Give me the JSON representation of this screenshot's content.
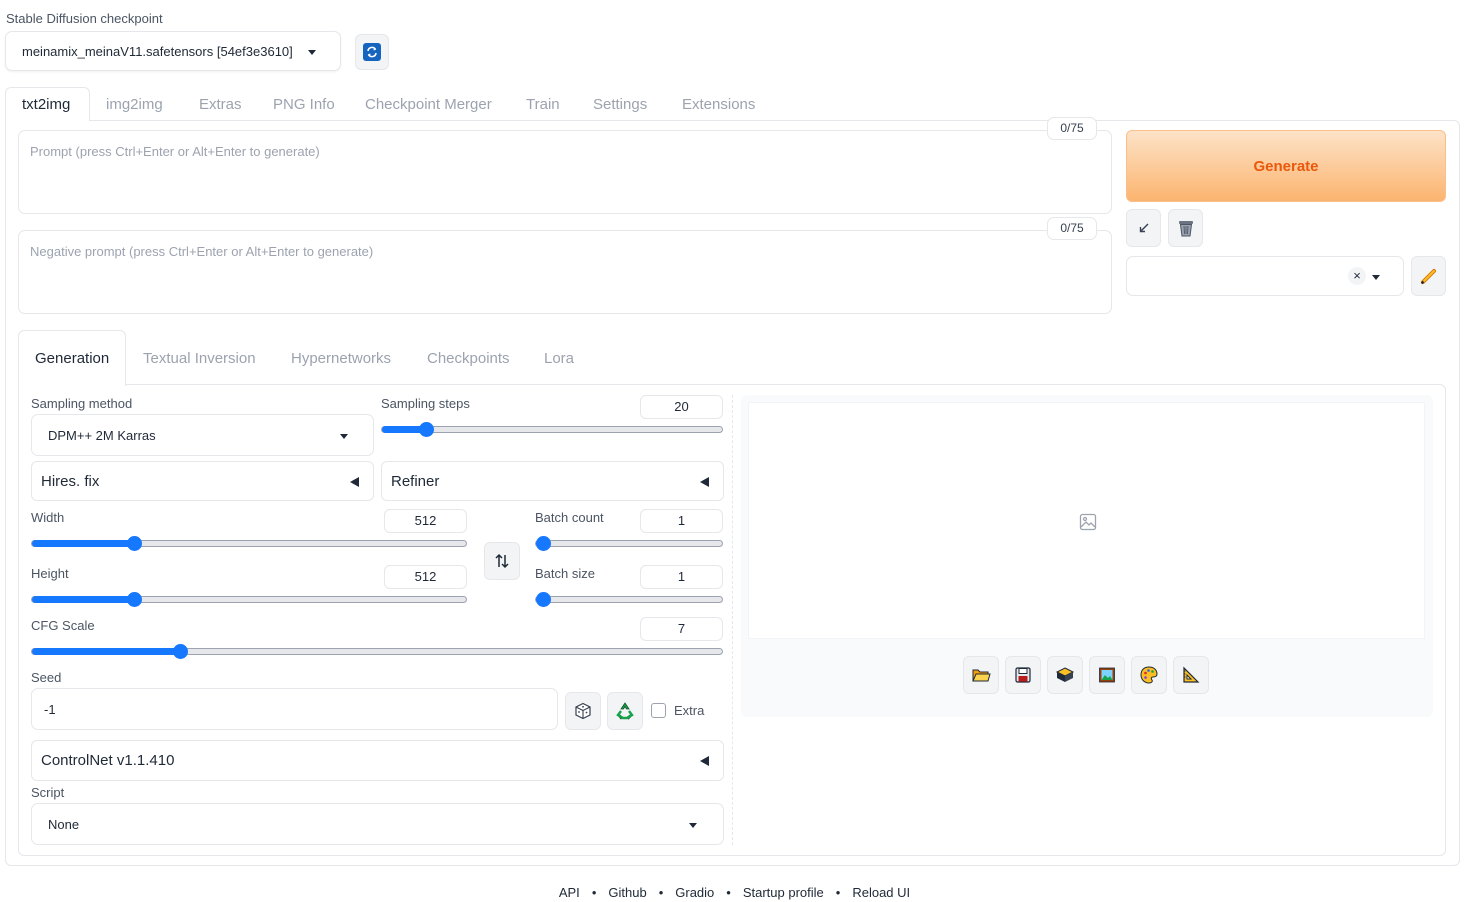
{
  "checkpoint": {
    "label": "Stable Diffusion checkpoint",
    "selected": "meinamix_meinaV11.safetensors [54ef3e3610]"
  },
  "main_tabs": [
    "txt2img",
    "img2img",
    "Extras",
    "PNG Info",
    "Checkpoint Merger",
    "Train",
    "Settings",
    "Extensions"
  ],
  "prompt": {
    "placeholder": "Prompt (press Ctrl+Enter or Alt+Enter to generate)",
    "token_count": "0/75"
  },
  "negative_prompt": {
    "placeholder": "Negative prompt (press Ctrl+Enter or Alt+Enter to generate)",
    "token_count": "0/75"
  },
  "generate_label": "Generate",
  "styles_clear": "×",
  "sub_tabs": [
    "Generation",
    "Textual Inversion",
    "Hypernetworks",
    "Checkpoints",
    "Lora"
  ],
  "sampling_method": {
    "label": "Sampling method",
    "value": "DPM++ 2M Karras"
  },
  "sampling_steps": {
    "label": "Sampling steps",
    "value": "20",
    "level": 0.13
  },
  "hires_fix": "Hires. fix",
  "refiner": "Refiner",
  "width": {
    "label": "Width",
    "value": "512",
    "level": 0.235
  },
  "height": {
    "label": "Height",
    "value": "512",
    "level": 0.235
  },
  "batch_count": {
    "label": "Batch count",
    "value": "1",
    "level": 0.0
  },
  "batch_size": {
    "label": "Batch size",
    "value": "1",
    "level": 0.0
  },
  "cfg_scale": {
    "label": "CFG Scale",
    "value": "7",
    "level": 0.214
  },
  "seed": {
    "label": "Seed",
    "value": "-1",
    "extra_label": "Extra"
  },
  "controlnet": "ControlNet v1.1.410",
  "script": {
    "label": "Script",
    "value": "None"
  },
  "footer": [
    "API",
    "Github",
    "Gradio",
    "Startup profile",
    "Reload UI"
  ],
  "colors": {
    "accent": "#1677ff",
    "generate_text": "#ea580c",
    "generate_bg_from": "#fdd9b5",
    "generate_bg_to": "#fbb06a"
  }
}
